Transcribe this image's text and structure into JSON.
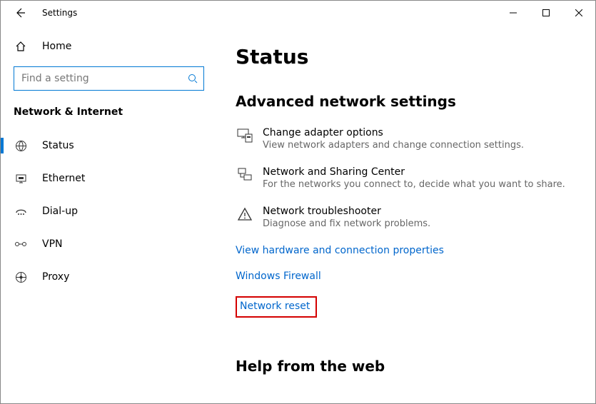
{
  "window": {
    "title": "Settings"
  },
  "sidebar": {
    "home": "Home",
    "search_placeholder": "Find a setting",
    "category": "Network & Internet",
    "items": [
      {
        "label": "Status",
        "icon": "globe-icon",
        "active": true
      },
      {
        "label": "Ethernet",
        "icon": "ethernet-icon",
        "active": false
      },
      {
        "label": "Dial-up",
        "icon": "dialup-icon",
        "active": false
      },
      {
        "label": "VPN",
        "icon": "vpn-icon",
        "active": false
      },
      {
        "label": "Proxy",
        "icon": "proxy-icon",
        "active": false
      }
    ]
  },
  "page": {
    "title": "Status",
    "section_title": "Advanced network settings",
    "options": [
      {
        "title": "Change adapter options",
        "desc": "View network adapters and change connection settings."
      },
      {
        "title": "Network and Sharing Center",
        "desc": "For the networks you connect to, decide what you want to share."
      },
      {
        "title": "Network troubleshooter",
        "desc": "Diagnose and fix network problems."
      }
    ],
    "links": [
      {
        "label": "View hardware and connection properties",
        "highlight": false
      },
      {
        "label": "Windows Firewall",
        "highlight": false
      },
      {
        "label": "Network reset",
        "highlight": true
      }
    ],
    "footer_heading": "Help from the web"
  }
}
